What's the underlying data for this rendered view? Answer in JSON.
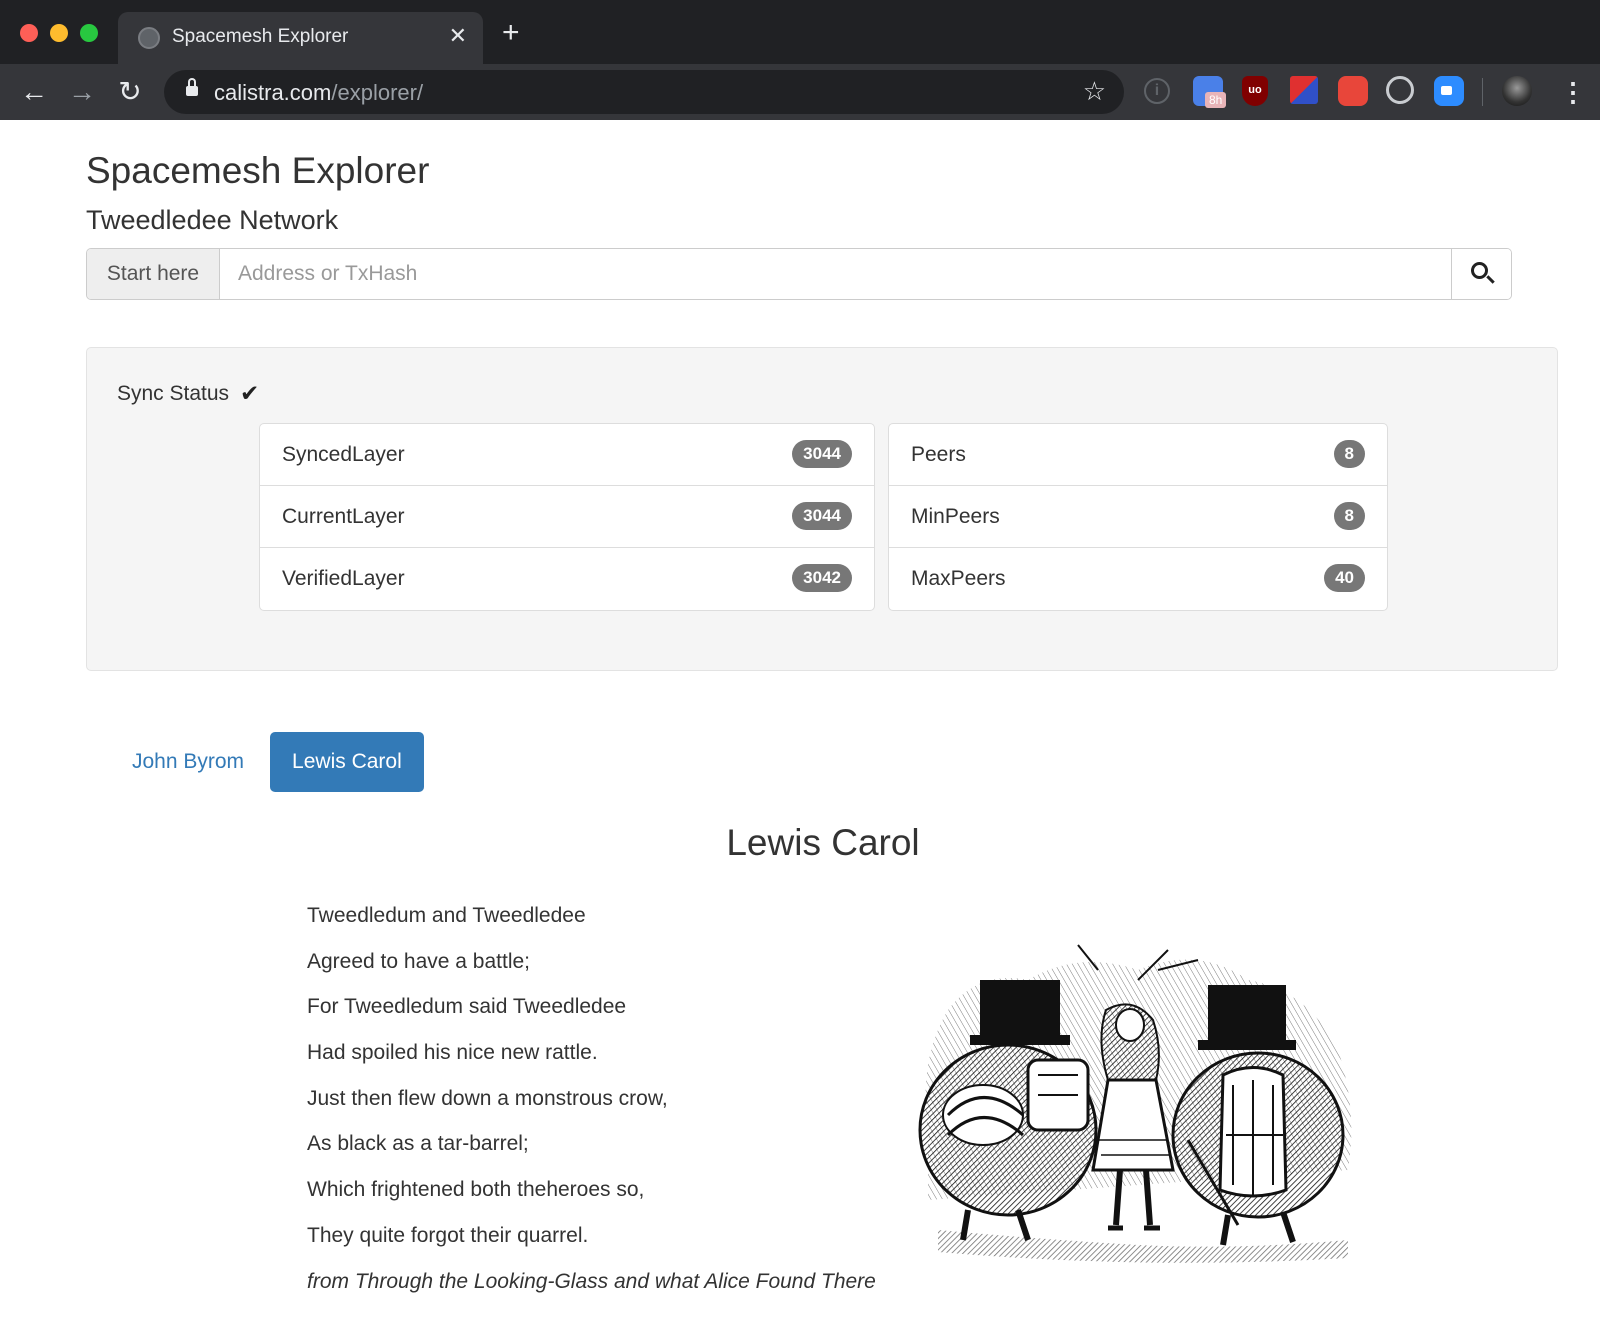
{
  "browser": {
    "tab_title": "Spacemesh Explorer",
    "url_domain": "calistra.com",
    "url_path": "/explorer/",
    "close_glyph": "✕",
    "new_tab_glyph": "+",
    "extensions": [
      {
        "icon": "info-icon"
      },
      {
        "icon": "calendar-extension-icon",
        "badge": "8h"
      },
      {
        "icon": "ublock-icon",
        "label": "uo"
      },
      {
        "icon": "red-blue-extension-icon"
      },
      {
        "icon": "ms-extension-icon"
      },
      {
        "icon": "circle-extension-icon"
      },
      {
        "icon": "zoom-icon"
      },
      {
        "icon": "profile-avatar-icon"
      }
    ]
  },
  "header": {
    "title": "Spacemesh Explorer",
    "subtitle": "Tweedledee Network"
  },
  "search": {
    "addon_label": "Start here",
    "placeholder": "Address or TxHash",
    "value": ""
  },
  "sync": {
    "label": "Sync Status",
    "status_icon": "✔",
    "left": [
      {
        "label": "SyncedLayer",
        "value": "3044"
      },
      {
        "label": "CurrentLayer",
        "value": "3044"
      },
      {
        "label": "VerifiedLayer",
        "value": "3042"
      }
    ],
    "right": [
      {
        "label": "Peers",
        "value": "8"
      },
      {
        "label": "MinPeers",
        "value": "8"
      },
      {
        "label": "MaxPeers",
        "value": "40"
      }
    ]
  },
  "tabs": [
    {
      "label": "John Byrom",
      "active": false
    },
    {
      "label": "Lewis Carol",
      "active": true
    }
  ],
  "poem": {
    "heading": "Lewis Carol",
    "lines": [
      "Tweedledum and Tweedledee",
      "Agreed to have a battle;",
      "For Tweedledum said Tweedledee",
      "Had spoiled his nice new rattle.",
      "Just then flew down a monstrous crow,",
      "As black as a tar-barrel;",
      "Which frightened both theheroes so,",
      "They quite forgot their quarrel."
    ],
    "source": "from Through the Looking-Glass and what Alice Found There"
  },
  "colors": {
    "chrome_bg": "#202124",
    "tab_bg": "#35363a",
    "link": "#337ab7",
    "badge": "#777777",
    "well": "#f5f5f5"
  }
}
